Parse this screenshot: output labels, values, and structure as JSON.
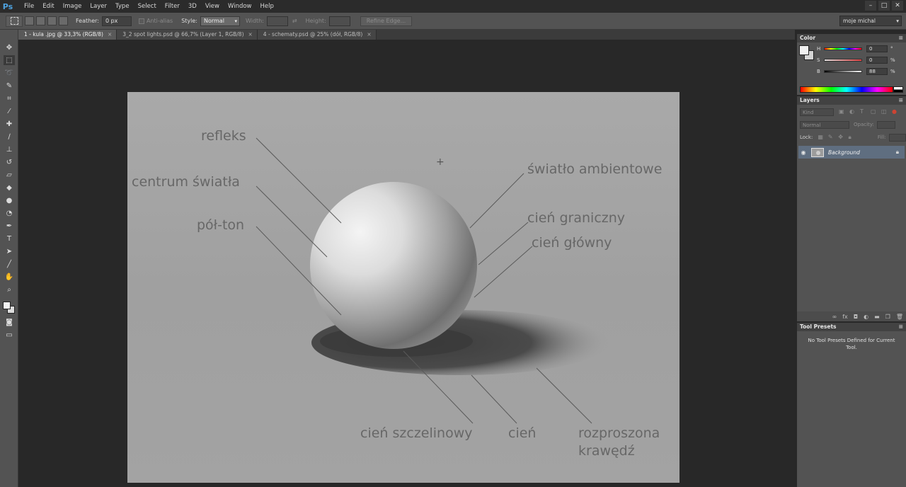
{
  "app": {
    "logo": "Ps"
  },
  "menu": [
    "File",
    "Edit",
    "Image",
    "Layer",
    "Type",
    "Select",
    "Filter",
    "3D",
    "View",
    "Window",
    "Help"
  ],
  "window_controls": [
    "–",
    "□",
    "✕"
  ],
  "options": {
    "feather_label": "Feather:",
    "feather_value": "0 px",
    "antialias_label": "Anti-alias",
    "style_label": "Style:",
    "style_value": "Normal",
    "width_label": "Width:",
    "height_label": "Height:",
    "refine_edge": "Refine Edge...",
    "workspace": "moje michal"
  },
  "tabs": [
    {
      "label": "1 - kula .jpg @ 33,3% (RGB/8)",
      "active": true
    },
    {
      "label": "3_2 spot lights.psd @ 66,7% (Layer 1, RGB/8)",
      "active": false
    },
    {
      "label": "4 - schematy.psd @ 25% (dół, RGB/8)",
      "active": false
    }
  ],
  "canvas_labels": {
    "refleks": "refleks",
    "centrum": "centrum światła",
    "polton": "pół-ton",
    "ambient": "światło ambientowe",
    "graniczny": "cień graniczny",
    "glowny": "cień główny",
    "szczelinowy": "cień szczelinowy",
    "cien": "cień",
    "rozproszona_1": "rozproszona",
    "rozproszona_2": "krawędź"
  },
  "color_panel": {
    "title": "Color",
    "h_label": "H",
    "h_value": "0",
    "h_unit": "°",
    "s_label": "S",
    "s_value": "0",
    "s_unit": "%",
    "b_label": "B",
    "b_value": "88",
    "b_unit": "%"
  },
  "layers_panel": {
    "title": "Layers",
    "kind": "Kind",
    "blend_mode": "Normal",
    "opacity_label": "Opacity:",
    "lock_label": "Lock:",
    "fill_label": "Fill:",
    "layer_name": "Background"
  },
  "presets_panel": {
    "title": "Tool Presets",
    "message": "No Tool Presets Defined for Current Tool."
  },
  "colors": {
    "app_bg": "#282828",
    "panel_bg": "#535353",
    "canvas_gray": "#9a9a9a",
    "selected_layer": "#5f6e80"
  }
}
